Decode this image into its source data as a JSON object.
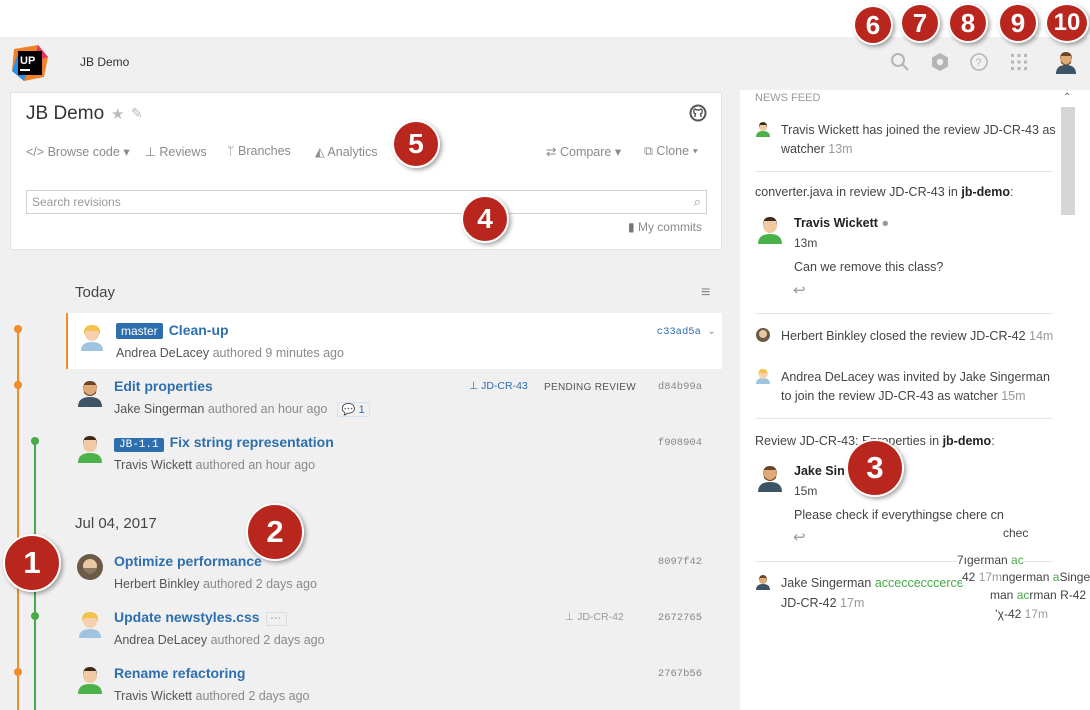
{
  "header": {
    "project": "JB Demo"
  },
  "project_card": {
    "title": "JB Demo",
    "nav": {
      "browse_code": "Browse code",
      "reviews": "Reviews",
      "branches": "Branches",
      "analytics": "Analytics",
      "compare": "Compare",
      "clone": "Clone"
    },
    "search": {
      "placeholder": "Search revisions"
    },
    "my_commits": "My commits"
  },
  "groups": [
    {
      "label": "Today"
    },
    {
      "label": "Jul 04, 2017"
    }
  ],
  "commits": [
    {
      "tag": "master",
      "title": "Clean-up",
      "author": "Andrea DeLacey",
      "time": "authored 9 minutes ago",
      "hash": "c33ad5a"
    },
    {
      "title": "Edit properties",
      "author": "Jake Singerman",
      "time": "authored an hour ago",
      "review": "JD-CR-43",
      "status": "PENDING REVIEW",
      "comments": "1",
      "hash": "d84b99a"
    },
    {
      "tag": "JB-1.1",
      "title": "Fix string representation",
      "author": "Travis Wickett",
      "time": "authored an hour ago",
      "hash": "f908904"
    },
    {
      "title": "Optimize performance",
      "author": "Herbert Binkley",
      "time": "authored 2 days ago",
      "hash": "8097f42"
    },
    {
      "title": "Update newstyles.css",
      "author": "Andrea DeLacey",
      "time": "authored 2 days ago",
      "review": "JD-CR-42",
      "hash": "2672765"
    },
    {
      "title": "Rename refactoring",
      "author": "Travis Wickett",
      "time": "authored 2 days ago",
      "hash": "2767b56"
    }
  ],
  "news_feed": {
    "header": "NEWS FEED",
    "item1": {
      "text": "Travis Wickett has joined the review JD-CR-43 as watcher",
      "time": "13m"
    },
    "group1": {
      "file": "converter.java",
      "mid": " in review JD-CR-43 in ",
      "repo": "jb-demo",
      "tail": ":",
      "author": "Travis Wickett",
      "time": "13m",
      "comment": "Can we remove this class?"
    },
    "item2": {
      "text": "Herbert Binkley closed the review JD-CR-42",
      "time": "14m"
    },
    "item3": {
      "text": "Andrea DeLacey was invited by Jake Singerman to join the review JD-CR-43 as watcher",
      "time": "15m"
    },
    "group2": {
      "prefix": "Review JD-CR-43: E",
      "mid": "properties in ",
      "repo": "jb-demo",
      "tail": ":",
      "author": "Jake Sin",
      "time": "15m",
      "comment": "Please check if everything",
      "comment_glitch": "se chere cn",
      "glitch2": "chec"
    },
    "item4": {
      "author": "Jake Singerman",
      "accepted": "acceccecccerce",
      "line2": "JD-CR-42",
      "time": "17m",
      "ov1a": "7ıgerman",
      "ov1b": "ac",
      "ov2a": "42",
      "ov2b": "17m",
      "ov2c": "ngerman",
      "ov2d": "a",
      "ov2e": "Singe",
      "ov3a": "man",
      "ov3b": "ac",
      "ov3c": "rman",
      "ov3d": "R-42",
      "ov4a": "’χ-42",
      "ov4b": "17m"
    }
  },
  "markers": [
    "1",
    "2",
    "3",
    "4",
    "5",
    "6",
    "7",
    "8",
    "9",
    "10"
  ],
  "colors": {
    "link": "#2d6fae",
    "orange": "#f08c2a",
    "green": "#48a947",
    "marker": "#b9261e"
  }
}
